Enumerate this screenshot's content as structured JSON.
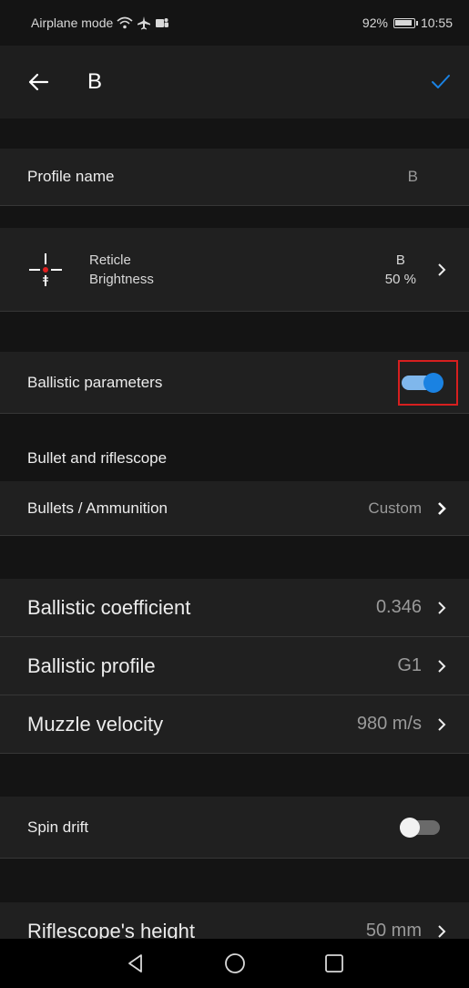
{
  "status_bar": {
    "left_text": "Airplane mode",
    "battery": "92%",
    "time": "10:55"
  },
  "app_bar": {
    "title": "B"
  },
  "profile_name": {
    "label": "Profile name",
    "value": "B"
  },
  "reticle": {
    "label_line1": "Reticle",
    "label_line2": "Brightness",
    "value_line1": "B",
    "value_line2": "50 %"
  },
  "ballistic_parameters": {
    "label": "Ballistic parameters",
    "enabled": true
  },
  "bullet_section": {
    "header": "Bullet and riflescope"
  },
  "bullets": {
    "label": "Bullets / Ammunition",
    "value": "Custom"
  },
  "ballistic_coefficient": {
    "label": "Ballistic coefficient",
    "value": "0.346"
  },
  "ballistic_profile": {
    "label": "Ballistic profile",
    "value": "G1"
  },
  "muzzle_velocity": {
    "label": "Muzzle velocity",
    "value": "980 m/s"
  },
  "spin_drift": {
    "label": "Spin drift",
    "enabled": false
  },
  "riflescope_height": {
    "label": "Riflescope's height",
    "value": "50 mm"
  },
  "colors": {
    "accent": "#1a82e2",
    "highlight": "#d61f1f",
    "background": "#141414",
    "row": "#202020"
  }
}
